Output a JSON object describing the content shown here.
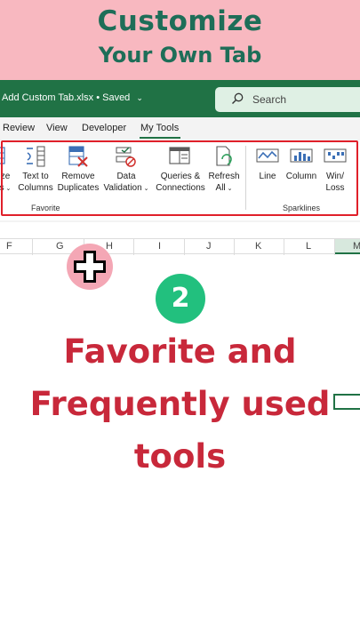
{
  "banner": {
    "line1": "Customize",
    "line2": "Your Own Tab"
  },
  "titlebar": {
    "filename": "Add Custom Tab.xlsx",
    "saved": "Saved",
    "search_placeholder": "Search"
  },
  "tabs": [
    {
      "label": "Review"
    },
    {
      "label": "View"
    },
    {
      "label": "Developer"
    },
    {
      "label": "My Tools",
      "active": true
    }
  ],
  "ribbon": {
    "favorite_group": {
      "label": "Favorite",
      "buttons": [
        {
          "label1": "ze",
          "label2": "s",
          "icon": "resize-icon"
        },
        {
          "label1": "Text to",
          "label2": "Columns",
          "icon": "text-to-columns-icon"
        },
        {
          "label1": "Remove",
          "label2": "Duplicates",
          "icon": "remove-duplicates-icon"
        },
        {
          "label1": "Data",
          "label2": "Validation",
          "icon": "data-validation-icon"
        },
        {
          "label1": "Queries &",
          "label2": "Connections",
          "icon": "queries-connections-icon"
        },
        {
          "label1": "Refresh",
          "label2": "All",
          "icon": "refresh-all-icon"
        }
      ]
    },
    "sparklines_group": {
      "label": "Sparklines",
      "buttons": [
        {
          "label1": "Line",
          "icon": "sparkline-line-icon"
        },
        {
          "label1": "Column",
          "icon": "sparkline-column-icon"
        },
        {
          "label1": "Win/",
          "label2": "Loss",
          "icon": "sparkline-winloss-icon"
        }
      ]
    }
  },
  "columns": [
    "F",
    "G",
    "H",
    "I",
    "J",
    "K",
    "L",
    "M"
  ],
  "step_number": "2",
  "headline": {
    "line1": "Favorite and",
    "line2": "Frequently used",
    "line3": "tools"
  },
  "colors": {
    "excel_green": "#207245",
    "banner_pink": "#f8b8c0",
    "headline_red": "#c8283a",
    "step_green": "#22c07e",
    "highlight_red": "#e0202a"
  }
}
